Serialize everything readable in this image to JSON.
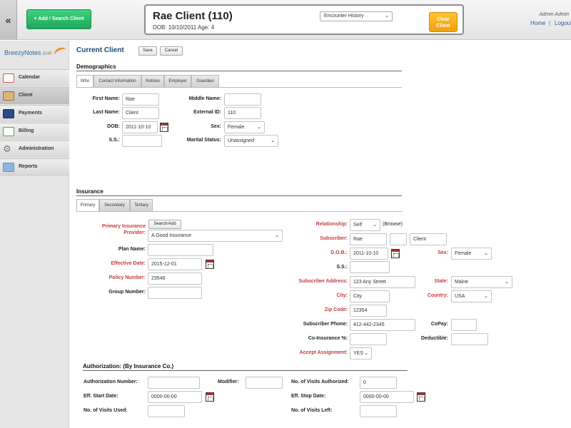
{
  "topbar": {
    "collapse_glyph": "«",
    "add_search_label": "+ Add / Search Client",
    "client_name": "Rae Client (110)",
    "client_dob_age": "DOB: 10/10/2011 Age: 4",
    "encounter_select": "Encounter History",
    "clear_label": "Clear Client",
    "admin_name": "Admin Admin",
    "home_link": "Home",
    "separator": "|",
    "logout_link": "Logout"
  },
  "sidebar": {
    "logo_text": "BreezyNotes",
    "logo_suffix": "EHR",
    "items": [
      {
        "label": "Calendar",
        "icon": "calendar-icon",
        "color": "#e05050"
      },
      {
        "label": "Client",
        "icon": "client-icon",
        "color": "#b88a4a"
      },
      {
        "label": "Payments",
        "icon": "payments-icon",
        "color": "#2a4a8a"
      },
      {
        "label": "Billing",
        "icon": "billing-icon",
        "color": "#4aa84a"
      },
      {
        "label": "Administration",
        "icon": "gear-icon",
        "color": "#777777"
      },
      {
        "label": "Reports",
        "icon": "reports-icon",
        "color": "#5b8fc9"
      }
    ]
  },
  "main": {
    "title": "Current Client",
    "save_label": "Save",
    "cancel_label": "Cancel",
    "demographics": {
      "heading": "Demographics",
      "tabs": [
        "Who",
        "Contact Information",
        "Notices",
        "Employer",
        "Guardian"
      ],
      "first_name_label": "First Name:",
      "first_name": "Rae",
      "last_name_label": "Last Name:",
      "last_name": "Client",
      "dob_label": "DOB:",
      "dob": "2011-10-10",
      "ss_label": "S.S.:",
      "ss": "",
      "middle_name_label": "Middle Name:",
      "middle_name": "",
      "external_id_label": "External ID:",
      "external_id": "110",
      "sex_label": "Sex:",
      "sex": "Female",
      "marital_label": "Marital Status:",
      "marital": "Unassigned"
    },
    "insurance": {
      "heading": "Insurance",
      "tabs": [
        "Primary",
        "Secondary",
        "Tertiary"
      ],
      "provider_label_1": "Primary Insurance",
      "provider_label_2": "Provider:",
      "search_add_label": "Search/Add",
      "provider": "A Good Insurance",
      "plan_name_label": "Plan Name:",
      "plan_name": "",
      "effective_date_label": "Effective Date:",
      "effective_date": "2015-12-01",
      "policy_number_label": "Policy Number:",
      "policy_number": "23546",
      "group_number_label": "Group Number:",
      "group_number": "",
      "relationship_label": "Relationship:",
      "relationship": "Self",
      "browse_label": "(Browse)",
      "subscriber_label": "Subscriber:",
      "subscriber_first": "Rae",
      "subscriber_middle": "",
      "subscriber_last": "Client",
      "sub_dob_label": "D.O.B.:",
      "sub_dob": "2011-10-10",
      "sub_sex_label": "Sex:",
      "sub_sex": "Female",
      "sub_ss_label": "S.S.:",
      "sub_ss": "",
      "address_label": "Subscriber Address:",
      "address": "123 Any Street",
      "state_label": "State:",
      "state": "Maine",
      "city_label": "City:",
      "city": "City",
      "country_label": "Country:",
      "country": "USA",
      "zip_label": "Zip Code:",
      "zip": "12354",
      "phone_label": "Subscriber Phone:",
      "phone": "412-442-2345",
      "copay_label": "CoPay:",
      "copay": "",
      "coins_label": "Co-Insurance %:",
      "coins": "",
      "deductible_label": "Deductible:",
      "deductible": "",
      "accept_label": "Accept Assignment:",
      "accept": "YES"
    },
    "authorization": {
      "heading": "Authorization: (By Insurance Co.)",
      "auth_number_label": "Authorization Number:",
      "auth_number": "",
      "modifier_label": "Modifier:",
      "modifier": "",
      "visits_authorized_label": "No. of Visits Authorized:",
      "visits_authorized": "0",
      "start_date_label": "Eff. Start Date:",
      "start_date": "0000-00-00",
      "stop_date_label": "Eff. Stop Date:",
      "stop_date": "0000-00-00",
      "visits_used_label": "No. of Visits Used:",
      "visits_used": "",
      "visits_left_label": "No. of Visits Left:",
      "visits_left": ""
    }
  }
}
